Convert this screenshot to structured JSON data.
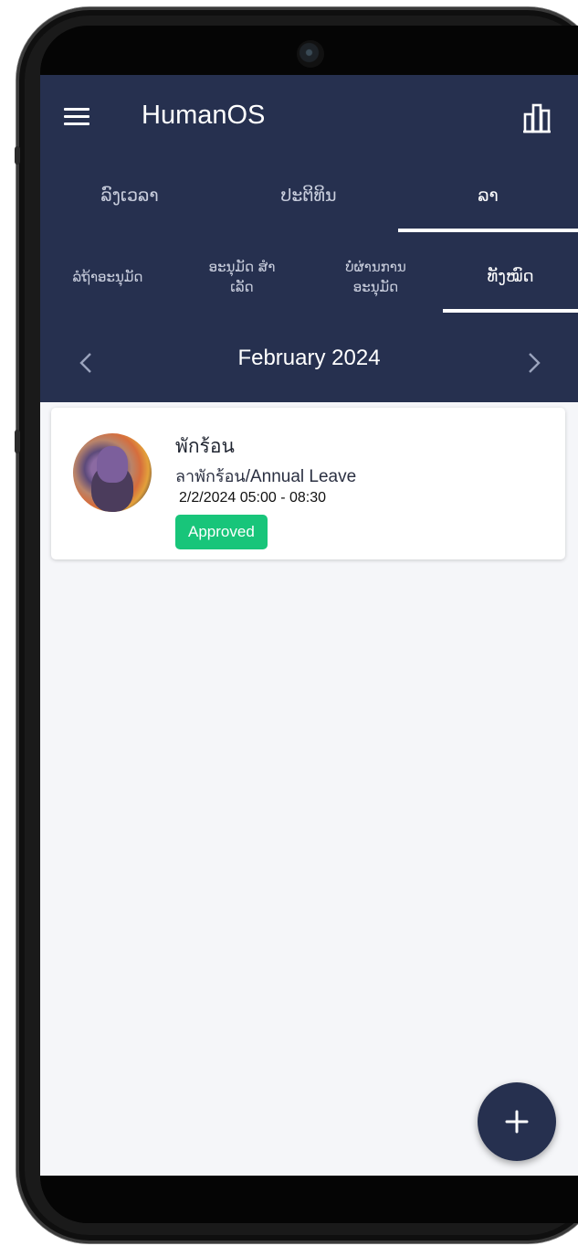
{
  "app": {
    "title": "HumanOS"
  },
  "top_tabs": [
    {
      "label": "ລົງເວລາ",
      "active": false
    },
    {
      "label": "ປະຕິທິນ",
      "active": false
    },
    {
      "label": "ລາ",
      "active": true
    }
  ],
  "sub_tabs": [
    {
      "label": "ລໍຖ້າອະນຸມັດ",
      "active": false
    },
    {
      "label": "ອະນຸມັດ ສໍາເລັດ",
      "active": false
    },
    {
      "label": "ບໍ່ຜ່ານການ ອະນຸມັດ",
      "active": false
    },
    {
      "label": "ທັງໝົດ",
      "active": true
    }
  ],
  "month": {
    "label": "February 2024"
  },
  "leave_items": [
    {
      "title": "พักร้อน",
      "type_local": "ลาพักร้อน",
      "type_english": "/Annual Leave",
      "time": "2/2/2024 05:00 - 08:30",
      "status": "Approved",
      "status_color": "#18c57a"
    }
  ],
  "icons": {
    "menu": "menu-icon",
    "chart": "bar-chart-icon",
    "prev": "chevron-left-icon",
    "next": "chevron-right-icon",
    "add": "plus-icon"
  },
  "colors": {
    "header": "#26304f",
    "background": "#f5f6f9",
    "accent": "#18c57a"
  }
}
